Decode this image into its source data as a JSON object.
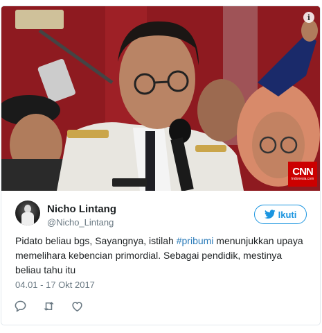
{
  "media": {
    "info_icon": "info-icon",
    "badge": {
      "logo": "CNN",
      "sub": "Indonesia.com",
      "color": "#cc0000"
    }
  },
  "author": {
    "name": "Nicho Lintang",
    "handle": "@Nicho_Lintang",
    "avatar_icon": "avatar"
  },
  "follow_button": {
    "label": "Ikuti",
    "icon": "twitter-bird-icon",
    "color": "#1b95e0"
  },
  "tweet": {
    "text_before": "Pidato beliau bgs, Sayangnya, istilah ",
    "hashtag": "#pribumi",
    "text_after": " menunjukkan upaya memelihara kebencian primordial. Sebagai pendidik, mestinya beliau tahu itu",
    "hashtag_color": "#2b7bb9"
  },
  "timestamp": "04.01 - 17 Okt 2017",
  "actions": [
    {
      "name": "reply-icon"
    },
    {
      "name": "retweet-icon"
    },
    {
      "name": "like-icon"
    }
  ]
}
